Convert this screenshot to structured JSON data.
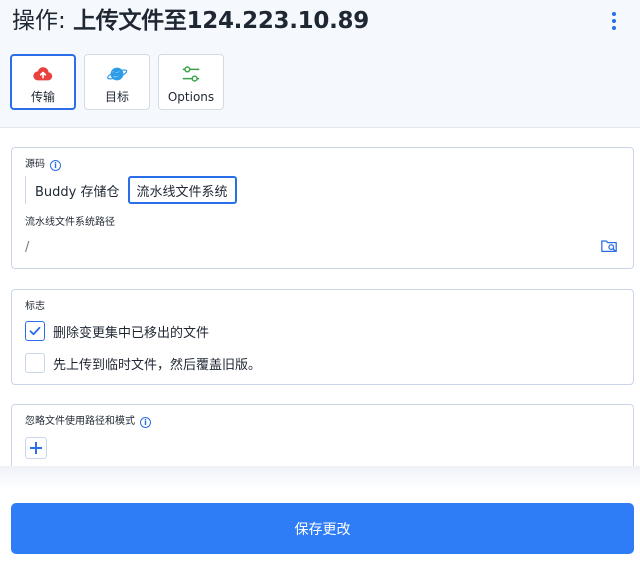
{
  "header": {
    "title_prefix": "操作: ",
    "title_target": "上传文件至124.223.10.89",
    "tabs": [
      {
        "label": "传输",
        "icon": "cloud-upload-icon",
        "active": true
      },
      {
        "label": "目标",
        "icon": "planet-icon",
        "active": false
      },
      {
        "label": "Options",
        "icon": "sliders-icon",
        "active": false
      }
    ]
  },
  "source": {
    "title": "源码",
    "options": [
      "Buddy 存储仓",
      "流水线文件系统"
    ],
    "selected": "流水线文件系统",
    "path_label": "流水线文件系统路径",
    "path_value": "/"
  },
  "flags": {
    "title": "标志",
    "items": [
      {
        "label": "删除变更集中已移出的文件",
        "checked": true
      },
      {
        "label": "先上传到临时文件，然后覆盖旧版。",
        "checked": false
      }
    ]
  },
  "ignore": {
    "title": "忽略文件使用路径和模式"
  },
  "footer": {
    "save_label": "保存更改"
  },
  "colors": {
    "accent": "#2a6ee8",
    "button": "#2f7df6",
    "cloud_red": "#e8413e",
    "planet_blue": "#2e9be6",
    "sliders_green": "#3aa34a"
  }
}
